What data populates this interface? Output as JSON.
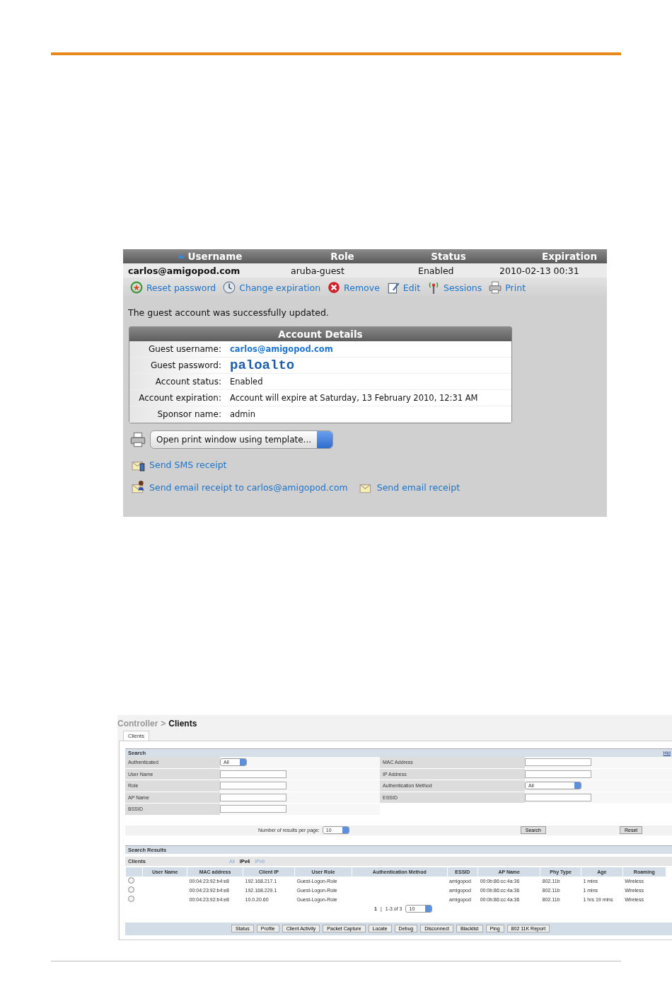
{
  "guest_panel": {
    "columns": [
      {
        "label": "Username",
        "sorted": true
      },
      {
        "label": "Role",
        "sorted": false
      },
      {
        "label": "Status",
        "sorted": false
      },
      {
        "label": "Expiration",
        "sorted": false
      }
    ],
    "row": [
      "carlos@amigopod.com",
      "aruba-guest",
      "Enabled",
      "2010-02-13 00:31"
    ],
    "actions": [
      {
        "label": "Reset password",
        "kind": "reset"
      },
      {
        "label": "Change expiration",
        "kind": "clock"
      },
      {
        "label": "Remove",
        "kind": "remove"
      },
      {
        "label": "Edit",
        "kind": "edit"
      },
      {
        "label": "Sessions",
        "kind": "antenna"
      },
      {
        "label": "Print",
        "kind": "print"
      }
    ],
    "message": "The guest account was successfully updated.",
    "details": {
      "title": "Account Details",
      "rows": [
        {
          "label": "Guest username:",
          "value": "carlos@amigopod.com",
          "kind": "link"
        },
        {
          "label": "Guest password:",
          "value": "paloalto",
          "kind": "password"
        },
        {
          "label": "Account status:",
          "value": "Enabled",
          "kind": "plain"
        },
        {
          "label": "Account expiration:",
          "value": "Account will expire at Saturday, 13 February 2010, 12:31 AM",
          "kind": "plain"
        },
        {
          "label": "Sponsor name:",
          "value": "admin",
          "kind": "plain"
        }
      ]
    },
    "print_select": {
      "value": "Open print window using template..."
    },
    "receipts": [
      [
        {
          "label": "Send SMS receipt",
          "kind": "sms"
        }
      ],
      [
        {
          "label": "Send email receipt to carlos@amigopod.com",
          "kind": "person-mail"
        },
        {
          "label": "Send email receipt",
          "kind": "mail"
        }
      ]
    ]
  },
  "clients_panel": {
    "breadcrumb": {
      "parent": "Controller",
      "separator": ">",
      "current": "Clients"
    },
    "tabs": [
      {
        "label": "Clients",
        "selected": true
      }
    ],
    "search": {
      "title": "Search",
      "hide_link": "Hid",
      "left_fields": [
        {
          "label": "Authenticated",
          "kind": "select",
          "value": "All"
        },
        {
          "label": "User Name",
          "kind": "text"
        },
        {
          "label": "Role",
          "kind": "text"
        },
        {
          "label": "AP Name",
          "kind": "text"
        },
        {
          "label": "BSSID",
          "kind": "text"
        }
      ],
      "right_fields": [
        {
          "label": "MAC Address",
          "kind": "text"
        },
        {
          "label": "IP Address",
          "kind": "text"
        },
        {
          "label": "Authentication Method",
          "kind": "select",
          "value": "All"
        },
        {
          "label": "ESSID",
          "kind": "text"
        }
      ],
      "per_page_label": "Number of results per page:",
      "per_page": "10",
      "buttons": [
        "Search",
        "Reset"
      ]
    },
    "results": {
      "title": "Search Results",
      "label": "Clients",
      "filters": [
        {
          "label": "All",
          "selected": false
        },
        {
          "label": "IPv4",
          "selected": true
        },
        {
          "label": "IPv6",
          "selected": false
        }
      ],
      "columns": [
        "User Name",
        "MAC address",
        "Client IP",
        "User Role",
        "Authentication Method",
        "ESSID",
        "AP Name",
        "Phy Type",
        "Age",
        "Roaming"
      ],
      "rows": [
        {
          "selected": false,
          "cells": [
            "",
            "00:04:23:92:b4:e8",
            "192.168.217.1",
            "Guest-Logon-Role",
            "",
            "amigopod",
            "00:0b:86:cc:4a:36",
            "802.11b",
            "1 mins",
            "Wireless"
          ]
        },
        {
          "selected": false,
          "cells": [
            "",
            "00:04:23:92:b4:e8",
            "192.168.229.1",
            "Guest-Logon-Role",
            "",
            "amigopod",
            "00:0b:86:cc:4a:36",
            "802.11b",
            "1 mins",
            "Wireless"
          ]
        },
        {
          "selected": false,
          "cells": [
            "",
            "00:04:23:92:b4:e8",
            "10.0.20.60",
            "Guest-Logon-Role",
            "",
            "amigopod",
            "00:0b:86:cc:4a:36",
            "802.11b",
            "1 hrs 19 mins",
            "Wireless"
          ]
        }
      ],
      "pager": {
        "page": "1",
        "separator": "|",
        "range": "1-3 of 3",
        "per_page": "10"
      },
      "buttons": [
        "Status",
        "Profile",
        "Client Activity",
        "Packet Capture",
        "Locate",
        "Debug",
        "Disconnect",
        "Blacklist",
        "Ping",
        "802 11K Report"
      ]
    }
  }
}
